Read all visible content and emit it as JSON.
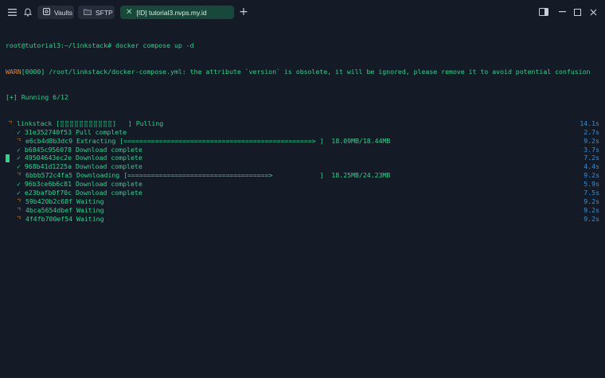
{
  "tabs": [
    {
      "label": "Vaults",
      "icon": "vault-icon"
    },
    {
      "label": "SFTP",
      "icon": "folder-icon"
    },
    {
      "label": "[ID] tutorial3.nvps.my.id",
      "icon": "close-icon",
      "active": true
    }
  ],
  "terminal": {
    "prompt_line": "root@tutorial3:~/linkstack# docker compose up -d",
    "warn_tag": "WARN",
    "warn_text": "[0000] /root/linkstack/docker-compose.yml: the attribute `version` is obsolete, it will be ignored, please remove it to avoid potential confusion",
    "running": "[+] Running 6/12",
    "rows": [
      {
        "mark": "⠙",
        "text": "linkstack [⣿⣿⣿⣿⣿⣿⣿⣿⣿⣿⣿]   ] Pulling",
        "time": "14.1s",
        "indent": false,
        "mark_type": "spin"
      },
      {
        "mark": "✓",
        "text": "31e352740f53 Pull complete",
        "time": "2.7s",
        "indent": true,
        "mark_type": "check"
      },
      {
        "mark": "⠙",
        "text": "e6cb4d8b3dc9 Extracting [================================================> ]  18.09MB/18.44MB",
        "time": "9.2s",
        "indent": true,
        "mark_type": "spin"
      },
      {
        "mark": "✓",
        "text": "b6845c956078 Download complete",
        "time": "3.7s",
        "indent": true,
        "mark_type": "check"
      },
      {
        "mark": "✓",
        "text": "49504643ec2e Download complete",
        "time": "7.2s",
        "indent": true,
        "mark_type": "check"
      },
      {
        "mark": "✓",
        "text": "968b41d1225a Download complete",
        "time": "4.4s",
        "indent": true,
        "mark_type": "check"
      },
      {
        "mark": "⠙",
        "text": "6bbb572c4fa5 Downloading [====================================>            ]  18.25MB/24.23MB",
        "time": "9.2s",
        "indent": true,
        "mark_type": "spin"
      },
      {
        "mark": "✓",
        "text": "96b3ce6b6c81 Download complete",
        "time": "5.9s",
        "indent": true,
        "mark_type": "check"
      },
      {
        "mark": "✓",
        "text": "e23bafb0f70c Download complete",
        "time": "7.5s",
        "indent": true,
        "mark_type": "check"
      },
      {
        "mark": "⠙",
        "text": "59b420b2c68f Waiting",
        "time": "9.2s",
        "indent": true,
        "mark_type": "spin"
      },
      {
        "mark": "⠙",
        "text": "4bca5654dbef Waiting",
        "time": "9.2s",
        "indent": true,
        "mark_type": "spin"
      },
      {
        "mark": "⠙",
        "text": "4f4fb700ef54 Waiting",
        "time": "9.2s",
        "indent": true,
        "mark_type": "spin"
      }
    ]
  },
  "colors": {
    "background": "#141a26",
    "terminal_text": "#2fd38a",
    "warn": "#e0863a",
    "time": "#3a8fd6",
    "active_tab": "#17483a"
  }
}
